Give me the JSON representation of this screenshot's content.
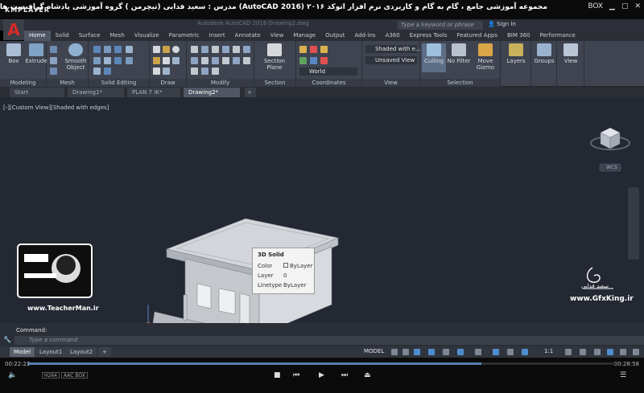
{
  "player": {
    "logo": "KMPLAYER",
    "title": "مجموعه آموزشی جامع ، گام به گام و کاربردی نرم افزار  اتوکد ۲۰۱۶ (AutoCAD 2016)  مدرس : سعید فدایی (تیچرمن ) گروه آموزشی پادشاه گرافیست ها",
    "box_label": "BOX",
    "time_current": "00:22:23",
    "time_total": "00:28:58",
    "progress": 0.77,
    "badges": [
      "H264",
      "AAC BOX"
    ]
  },
  "app": {
    "search_placeholder": "Type a keyword or phrase",
    "sign_in": "Sign In",
    "ghost_title": "Autodesk AutoCAD 2016   Drawing2.dwg"
  },
  "ribbon_tabs": [
    {
      "label": "Home",
      "active": true
    },
    {
      "label": "Solid"
    },
    {
      "label": "Surface"
    },
    {
      "label": "Mesh"
    },
    {
      "label": "Visualize"
    },
    {
      "label": "Parametric"
    },
    {
      "label": "Insert"
    },
    {
      "label": "Annotate"
    },
    {
      "label": "View"
    },
    {
      "label": "Manage"
    },
    {
      "label": "Output"
    },
    {
      "label": "Add-ins"
    },
    {
      "label": "A360"
    },
    {
      "label": "Express Tools"
    },
    {
      "label": "Featured Apps"
    },
    {
      "label": "BIM 360"
    },
    {
      "label": "Performance"
    }
  ],
  "ribbon": {
    "box": "Box",
    "extrude": "Extrude",
    "smooth_object": "Smooth Object",
    "section_plane": "Section Plane",
    "culling": "Culling",
    "no_filter": "No Filter",
    "move_gizmo": "Move Gizmo",
    "layers": "Layers",
    "groups": "Groups",
    "view": "View",
    "visual_style": "Shaded with e...",
    "unsaved_view": "Unsaved View",
    "world": "World",
    "groups_labels": {
      "modeling": "Modeling",
      "mesh": "Mesh",
      "solid_editing": "Solid Editing",
      "draw": "Draw",
      "modify": "Modify",
      "section": "Section",
      "coordinates": "Coordinates",
      "view": "View",
      "selection": "Selection"
    }
  },
  "doc_tabs": [
    {
      "label": "Start"
    },
    {
      "label": "Drawing1*"
    },
    {
      "label": "PLAN 7 IK*"
    },
    {
      "label": "Drawing2*",
      "active": true
    }
  ],
  "viewport": {
    "label": "[-][Custom View][Shaded with edges]",
    "viewcube_label": "WCS"
  },
  "tooltip": {
    "title": "3D Solid",
    "rows": [
      {
        "key": "Color",
        "value": "ByLayer"
      },
      {
        "key": "Layer",
        "value": "0"
      },
      {
        "key": "Linetype",
        "value": "ByLayer"
      }
    ]
  },
  "watermark": {
    "left_site": "www.TeacherMan.ir",
    "left_badge": "Teacher Man",
    "right_site": "www.GfxKing.ir",
    "right_name": "سعید فدایی"
  },
  "command": {
    "label": "Command:",
    "placeholder": "Type a command"
  },
  "layout_tabs": [
    {
      "label": "Model",
      "active": true
    },
    {
      "label": "Layout1"
    },
    {
      "label": "Layout2"
    }
  ],
  "status": {
    "model": "MODEL",
    "scale": "1:1"
  },
  "colors": {
    "accent": "#4e5563",
    "viewport_bg": "#232833",
    "brand": "#d62b2b"
  }
}
